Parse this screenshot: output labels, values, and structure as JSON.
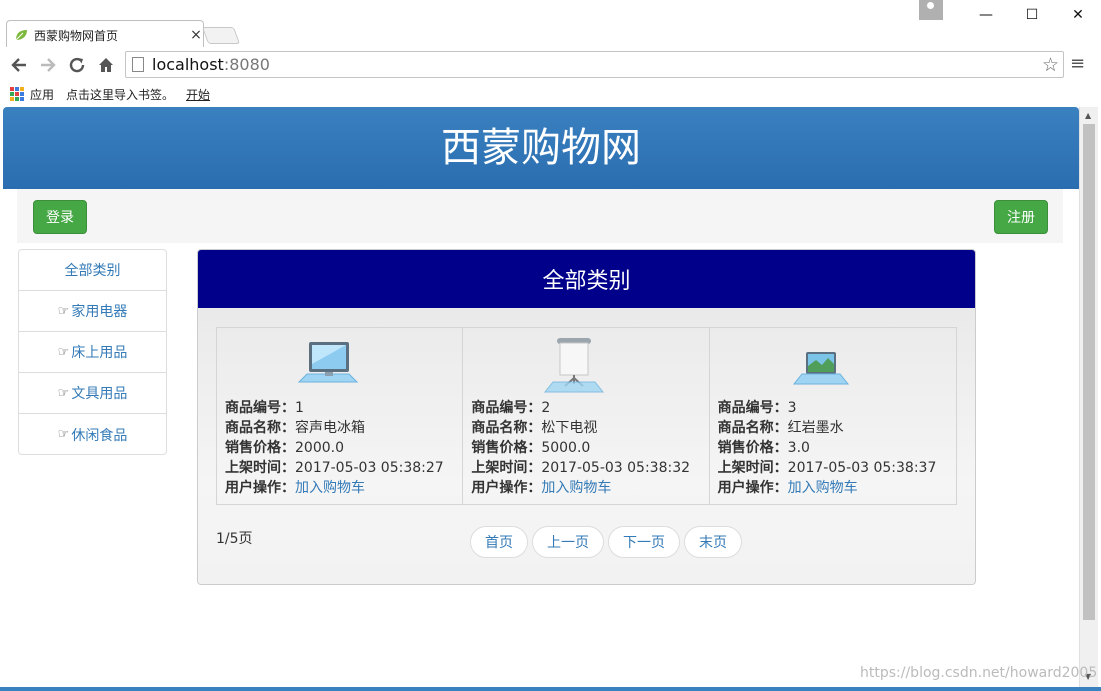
{
  "browser": {
    "tab_title": "西蒙购物网首页",
    "tab_close": "×",
    "url_host": "localhost",
    "url_port": ":8080",
    "window_min": "—",
    "window_max": "☐",
    "window_close": "✕",
    "bookmarks": [
      "应用",
      "点击这里导入书签。",
      "开始"
    ]
  },
  "site": {
    "title": "西蒙购物网",
    "login_label": "登录",
    "register_label": "注册"
  },
  "sidebar": {
    "items": [
      {
        "label": "全部类别"
      },
      {
        "label": "家用电器"
      },
      {
        "label": "床上用品"
      },
      {
        "label": "文具用品"
      },
      {
        "label": "休闲食品"
      }
    ]
  },
  "panel": {
    "heading": "全部类别",
    "field_labels": {
      "id": "商品编号：",
      "name": "商品名称：",
      "price": "销售价格：",
      "time": "上架时间：",
      "action": "用户操作："
    },
    "products": [
      {
        "id": "1",
        "name": "容声电冰箱",
        "price": "2000.0",
        "time": "2017-05-03 05:38:27",
        "action": "加入购物车",
        "icon": "monitor-icon"
      },
      {
        "id": "2",
        "name": "松下电视",
        "price": "5000.0",
        "time": "2017-05-03 05:38:32",
        "action": "加入购物车",
        "icon": "projector-screen-icon"
      },
      {
        "id": "3",
        "name": "红岩墨水",
        "price": "3.0",
        "time": "2017-05-03 05:38:37",
        "action": "加入购物车",
        "icon": "laptop-icon"
      }
    ],
    "page_info": "1/5页",
    "pager": [
      "首页",
      "上一页",
      "下一页",
      "末页"
    ]
  },
  "watermark": "https://blog.csdn.net/howard2005",
  "colors": {
    "banner": "#2f74b5",
    "panel_heading": "#00008b",
    "button_green": "#45a845",
    "link": "#337ab7"
  }
}
